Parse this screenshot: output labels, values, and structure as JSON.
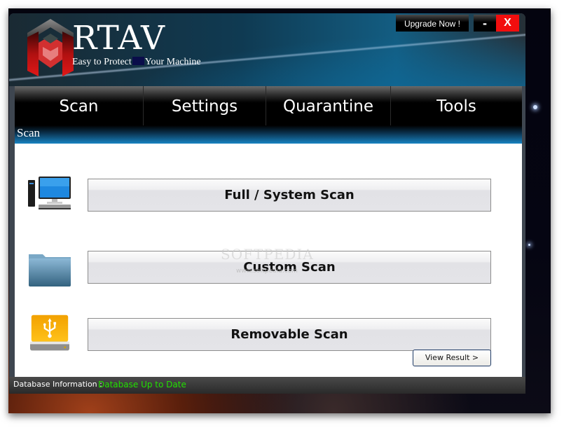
{
  "app": {
    "title": "RTAV",
    "tagline_left": "Easy to Protect",
    "tagline_right": "Your Machine"
  },
  "window_controls": {
    "upgrade_label": "Upgrade Now !",
    "minimize_label": "-",
    "close_label": "X"
  },
  "nav": {
    "tabs": [
      {
        "label": "Scan",
        "active": true
      },
      {
        "label": "Settings"
      },
      {
        "label": "Quarantine"
      },
      {
        "label": "Tools"
      }
    ]
  },
  "section": {
    "title": "Scan"
  },
  "scan_options": [
    {
      "label": "Full / System Scan",
      "icon": "computer-icon"
    },
    {
      "label": "Custom Scan",
      "icon": "folder-icon"
    },
    {
      "label": "Removable Scan",
      "icon": "usb-drive-icon"
    }
  ],
  "watermark": {
    "text": "SOFTPEDIA",
    "url": "www.softpedia.com"
  },
  "view_result_label": "View Result >",
  "status": {
    "label": "Database Information :",
    "value": "Database Up to Date",
    "value_color": "#22e000"
  },
  "colors": {
    "close_button": "#f20e0e",
    "section_bar_accent": "#1883c2"
  }
}
